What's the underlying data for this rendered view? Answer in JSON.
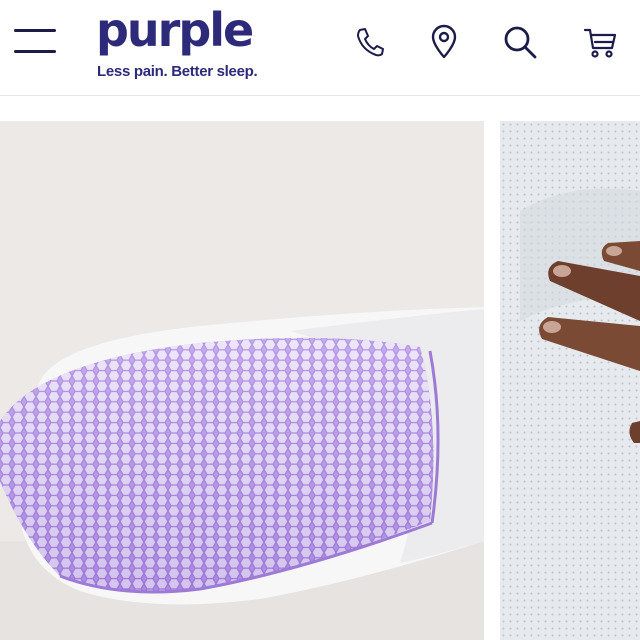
{
  "header": {
    "brand": "purple",
    "tagline": "Less pain. Better sleep.",
    "icons": {
      "menu": "hamburger-menu-icon",
      "phone": "phone-icon",
      "location": "location-pin-icon",
      "search": "search-icon",
      "cart": "cart-icon"
    }
  },
  "gallery": {
    "slides": [
      {
        "name": "purple-grid-pillow-image"
      },
      {
        "name": "hand-pressing-pillow-image"
      }
    ]
  },
  "colors": {
    "brand": "#2d2a7a",
    "icon": "#1c1c4a",
    "grid_purple": "#b79be8"
  }
}
